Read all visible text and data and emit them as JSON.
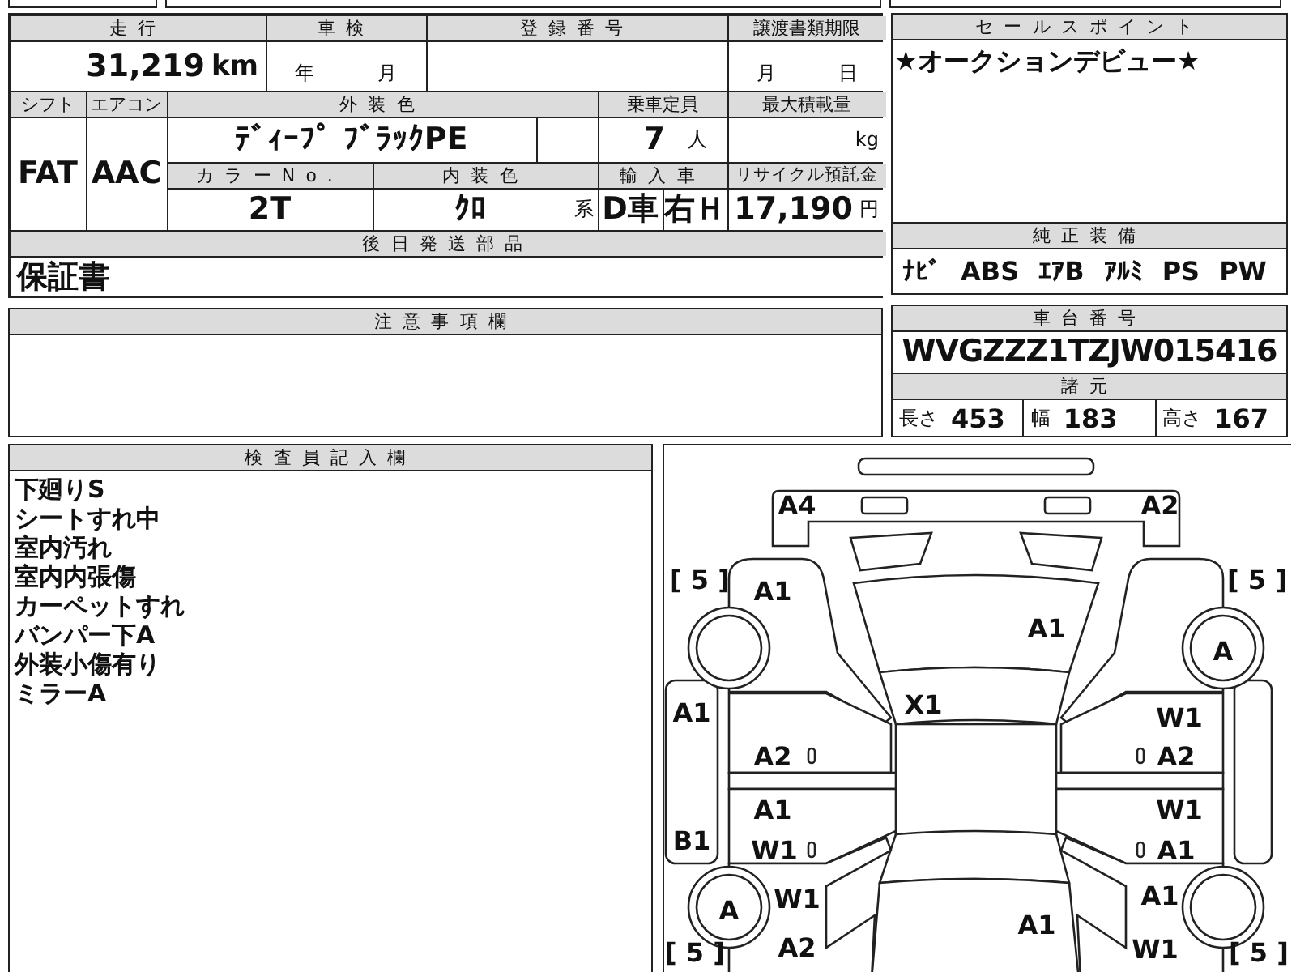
{
  "mileage": {
    "label": "走行",
    "value": "31,219",
    "unit": "km"
  },
  "inspection": {
    "label": "車検",
    "year": "年",
    "month": "月"
  },
  "registration_number": {
    "label": "登録番号"
  },
  "transfer_deadline": {
    "label": "譲渡書類期限",
    "month": "月",
    "day": "日"
  },
  "shift": {
    "label": "シフト",
    "value": "FAT"
  },
  "aircon": {
    "label": "エアコン",
    "value": "AAC"
  },
  "exterior_color": {
    "label": "外装色",
    "value": "ﾃﾞｨｰﾌﾟ ﾌﾞﾗｯｸPE"
  },
  "capacity": {
    "label": "乗車定員",
    "value": "7",
    "unit": "人"
  },
  "max_load": {
    "label": "最大積載量",
    "unit": "kg"
  },
  "color_no": {
    "label": "カラーNo.",
    "value": "2T"
  },
  "interior_color": {
    "label": "内装色",
    "value": "ｸﾛ",
    "suffix": "系"
  },
  "import": {
    "label": "輸入車",
    "dealer": "D車",
    "handle": "右Ｈ"
  },
  "recycle_fee": {
    "label": "リサイクル預託金",
    "value": "17,190",
    "unit": "円"
  },
  "later_parts": {
    "label": "後日発送部品",
    "value": "保証書"
  },
  "notes": {
    "label": "注意事項欄"
  },
  "sales_points": {
    "label": "セールスポイント",
    "value": "★オークションデビュー★"
  },
  "equipment": {
    "label": "純正装備",
    "items": [
      "ﾅﾋﾞ",
      "ABS",
      "ｴｱB",
      "ｱﾙﾐ",
      "PS",
      "PW"
    ]
  },
  "chassis": {
    "label": "車台番号",
    "value": "WVGZZZ1TZJW015416"
  },
  "specs": {
    "label": "諸元",
    "items": [
      {
        "label": "長さ",
        "value": "453"
      },
      {
        "label": "幅",
        "value": "183"
      },
      {
        "label": "高さ",
        "value": "167"
      }
    ]
  },
  "inspector": {
    "label": "検査員記入欄",
    "lines": [
      "下廻りS",
      "シートすれ中",
      "室内汚れ",
      "室内内張傷",
      "カーペットすれ",
      "バンパー下A",
      "外装小傷有り",
      "ミラーA"
    ]
  },
  "diagram": {
    "marks": [
      "A4",
      "A2",
      "[ 5 ]",
      "A1",
      "[ 5 ]",
      "A1",
      "A",
      "X1",
      "A1",
      "W1",
      "A2",
      "A2",
      "A1",
      "W1",
      "B1",
      "W1",
      "A1",
      "A",
      "W1",
      "A1",
      "A1",
      "[ 5 ]",
      "A2",
      "W1",
      "[ 5 ]"
    ]
  }
}
